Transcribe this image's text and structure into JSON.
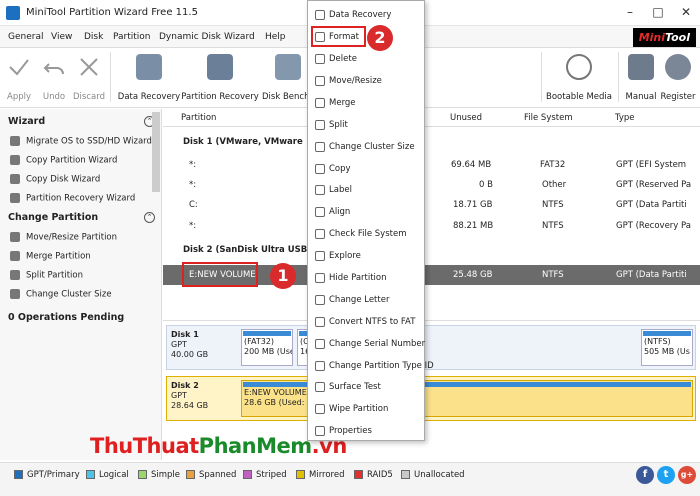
{
  "title": "MiniTool Partition Wizard Free 11.5",
  "menu": [
    "General",
    "View",
    "Disk",
    "Partition",
    "Dynamic Disk",
    "Wizard",
    "Help"
  ],
  "logo": {
    "mini": "Mini",
    "tool": "Tool"
  },
  "toolbar": {
    "apply": "Apply",
    "undo": "Undo",
    "discard": "Discard",
    "data_recovery": "Data Recovery",
    "partition_recovery": "Partition Recovery",
    "disk_benchmark": "Disk Benchm",
    "bootable_media": "Bootable Media",
    "manual": "Manual",
    "register": "Register"
  },
  "sidebar": {
    "wizard": "Wizard",
    "wizard_items": [
      "Migrate OS to SSD/HD Wizard",
      "Copy Partition Wizard",
      "Copy Disk Wizard",
      "Partition Recovery Wizard"
    ],
    "change_partition": "Change Partition",
    "change_items": [
      "Move/Resize Partition",
      "Merge Partition",
      "Split Partition",
      "Change Cluster Size"
    ],
    "pending": "0 Operations Pending"
  },
  "table": {
    "headers": {
      "partition": "Partition",
      "unused": "Unused",
      "fs": "File System",
      "type": "Type"
    },
    "disk1": "Disk 1 (VMware, VMware",
    "disk2": "Disk 2 (SanDisk Ultra USB",
    "rows": [
      {
        "p": "*:",
        "u": "69.64 MB",
        "fs": "FAT32",
        "t": "GPT (EFI System"
      },
      {
        "p": "*:",
        "u": "0 B",
        "fs": "Other",
        "t": "GPT (Reserved Pa"
      },
      {
        "p": "C:",
        "u": "18.71 GB",
        "fs": "NTFS",
        "t": "GPT (Data Partiti"
      },
      {
        "p": "*:",
        "u": "88.21 MB",
        "fs": "NTFS",
        "t": "GPT (Recovery Pa"
      }
    ],
    "sel": {
      "p": "E:NEW VOLUME",
      "u": "25.48 GB",
      "fs": "NTFS",
      "t": "GPT (Data Partiti"
    }
  },
  "diskmap": {
    "d1": {
      "name": "Disk 1",
      "scheme": "GPT",
      "size": "40.00 GB",
      "p1a": "(FAT32)",
      "p1b": "200 MB (Use",
      "p2a": "(O",
      "p2b": "16 M",
      "p3a": "(NTFS)",
      "p3b": "505 MB (Us"
    },
    "d2": {
      "name": "Disk 2",
      "scheme": "GPT",
      "size": "28.64 GB",
      "pa": "E:NEW VOLUME",
      "pb": "28.6 GB (Used:"
    }
  },
  "context_menu": [
    "Data Recovery",
    "Format",
    "Delete",
    "Move/Resize",
    "Merge",
    "Split",
    "Change Cluster Size",
    "Copy",
    "Label",
    "Align",
    "Check File System",
    "Explore",
    "Hide Partition",
    "Change Letter",
    "Convert NTFS to FAT",
    "Change Serial Number",
    "Change Partition Type ID",
    "Surface Test",
    "Wipe Partition",
    "Properties"
  ],
  "badges": {
    "one": "1",
    "two": "2"
  },
  "legend": [
    {
      "label": "GPT/Primary",
      "color": "#1f6fbf"
    },
    {
      "label": "Logical",
      "color": "#4ec3e8"
    },
    {
      "label": "Simple",
      "color": "#9ad66b"
    },
    {
      "label": "Spanned",
      "color": "#e8a040"
    },
    {
      "label": "Striped",
      "color": "#c060c0"
    },
    {
      "label": "Mirrored",
      "color": "#e0c000"
    },
    {
      "label": "RAID5",
      "color": "#e03030"
    },
    {
      "label": "Unallocated",
      "color": "#c8c8c8"
    }
  ],
  "social": {
    "fb": "f",
    "tw": "t",
    "gp": "g+"
  },
  "watermark": {
    "a": "ThuThuat",
    "b": "PhanMem",
    "c": ".vn"
  }
}
